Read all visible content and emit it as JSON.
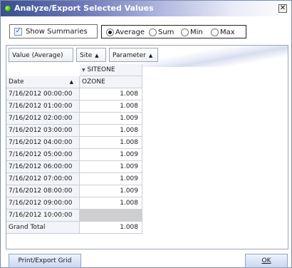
{
  "window": {
    "title": "Analyze/Export Selected Values",
    "close_glyph": "✕"
  },
  "summaries": {
    "checked": true,
    "label": "Show Summaries"
  },
  "aggregate": {
    "options": [
      "Average",
      "Sum",
      "Min",
      "Max"
    ],
    "selected": "Average"
  },
  "pivot": {
    "data_field": "Value (Average)",
    "column_fields": [
      "Site",
      "Parameter"
    ],
    "row_field": "Date",
    "site": "SITEONE",
    "parameter": "OZONE",
    "rows": [
      {
        "date": "7/16/2012 00:00:00",
        "value": "1.008"
      },
      {
        "date": "7/16/2012 01:00:00",
        "value": "1.008"
      },
      {
        "date": "7/16/2012 02:00:00",
        "value": "1.009"
      },
      {
        "date": "7/16/2012 03:00:00",
        "value": "1.008"
      },
      {
        "date": "7/16/2012 04:00:00",
        "value": "1.008"
      },
      {
        "date": "7/16/2012 05:00:00",
        "value": "1.009"
      },
      {
        "date": "7/16/2012 06:00:00",
        "value": "1.009"
      },
      {
        "date": "7/16/2012 07:00:00",
        "value": "1.009"
      },
      {
        "date": "7/16/2012 08:00:00",
        "value": "1.009"
      },
      {
        "date": "7/16/2012 09:00:00",
        "value": "1.008"
      },
      {
        "date": "7/16/2012 10:00:00",
        "value": ""
      }
    ],
    "grand_total_label": "Grand Total",
    "grand_total_value": "1.008"
  },
  "buttons": {
    "print_export": "Print/Export Grid",
    "ok": "OK"
  },
  "colors": {
    "title_dark": "#3a4f8f",
    "button_face": "#c9d7f0",
    "grid_border": "#c9ced9",
    "empty_cell": "#cfcfcf"
  },
  "icons": {
    "app": "green-status-dot-icon",
    "close": "close-icon",
    "sort": "sort-ascending-icon",
    "expand": "collapse-triangle-icon"
  }
}
